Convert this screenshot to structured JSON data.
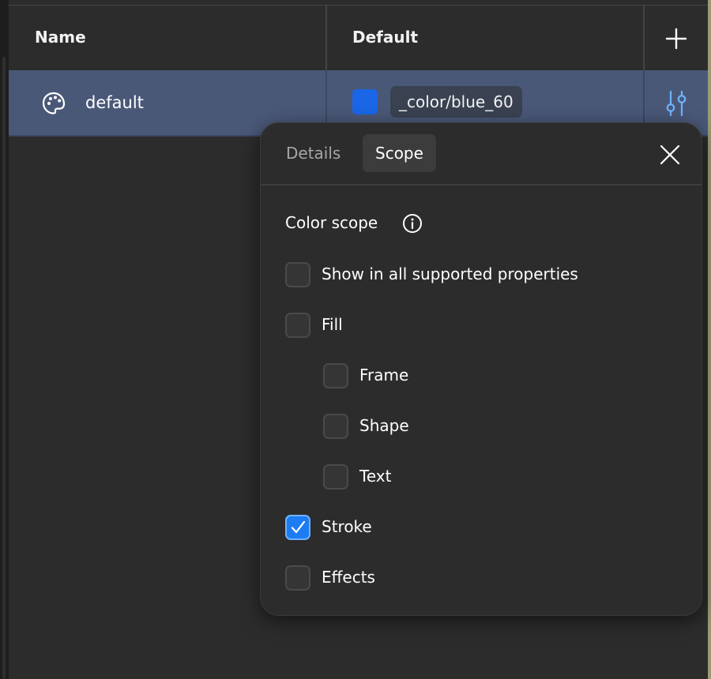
{
  "table": {
    "columns": [
      "Name",
      "Default"
    ],
    "add_icon": "plus-icon",
    "rows": [
      {
        "name": "default",
        "icon": "palette-icon",
        "swatch_color": "#1a66e6",
        "alias": "_color/blue_60",
        "edit_icon": "sliders-icon"
      }
    ]
  },
  "popover": {
    "tabs": [
      {
        "label": "Details",
        "active": false
      },
      {
        "label": "Scope",
        "active": true
      }
    ],
    "close_icon": "close-icon",
    "section_title": "Color scope",
    "info_icon": "info-icon",
    "options": [
      {
        "label": "Show in all supported properties",
        "checked": false
      },
      {
        "label": "Fill",
        "checked": false
      },
      {
        "label": "Frame",
        "checked": false
      },
      {
        "label": "Shape",
        "checked": false
      },
      {
        "label": "Text",
        "checked": false
      },
      {
        "label": "Stroke",
        "checked": true
      },
      {
        "label": "Effects",
        "checked": false
      }
    ]
  },
  "colors": {
    "background": "#2c2c2c",
    "selected_row": "#4a5878",
    "accent": "#1d7cf2",
    "accent_border": "#6fb4ff"
  }
}
